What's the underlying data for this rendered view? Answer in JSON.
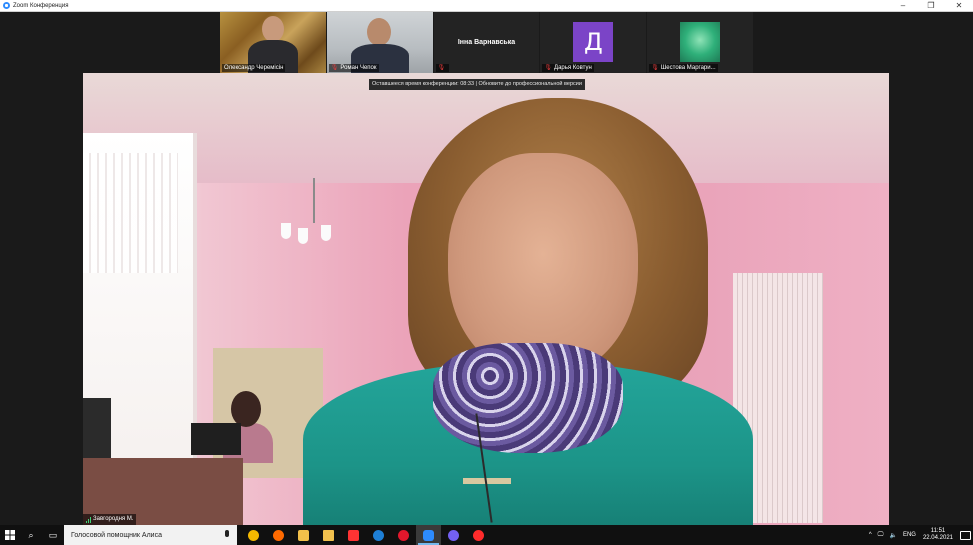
{
  "window": {
    "title": "Zoom Конференция",
    "minimize_glyph": "–",
    "maximize_glyph": "❐",
    "close_glyph": "✕"
  },
  "participants": [
    {
      "name": "Олександр Черемісін",
      "muted": false,
      "view": "video"
    },
    {
      "name": "Роман Чепок",
      "muted": true,
      "view": "video"
    },
    {
      "name": "Інна Варнавська",
      "muted": true,
      "view": "name"
    },
    {
      "name": "Дарья Ковтун",
      "muted": true,
      "view": "avatar",
      "avatar_letter": "Д"
    },
    {
      "name": "Шестова Маргари...",
      "muted": true,
      "view": "photo"
    }
  ],
  "banner": {
    "text": "Оставшееся время конференции: 08:33 | Обновите до профессиональной версии"
  },
  "active_speaker": {
    "name": "Завгородня М."
  },
  "taskbar": {
    "search_text": "Голосовой помощник Алиса",
    "apps": [
      {
        "icon": "yandex-disk-icon",
        "color": "#f5b900"
      },
      {
        "icon": "firefox-icon",
        "color": "#ff6a00"
      },
      {
        "icon": "store-icon",
        "color": "#f3c04a"
      },
      {
        "icon": "folder-icon",
        "color": "#f2c14e"
      },
      {
        "icon": "yandex-browser-icon",
        "color": "#ff3333"
      },
      {
        "icon": "edge-icon",
        "color": "#1e7fd6"
      },
      {
        "icon": "opera-icon",
        "color": "#e3172c"
      },
      {
        "icon": "zoom-icon",
        "color": "#2d8cff"
      },
      {
        "icon": "viber-icon",
        "color": "#7360f2"
      },
      {
        "icon": "yandex-icon",
        "color": "#ff2b2b"
      }
    ],
    "language": "ENG",
    "time": "11:51",
    "date": "22.04.2021"
  }
}
